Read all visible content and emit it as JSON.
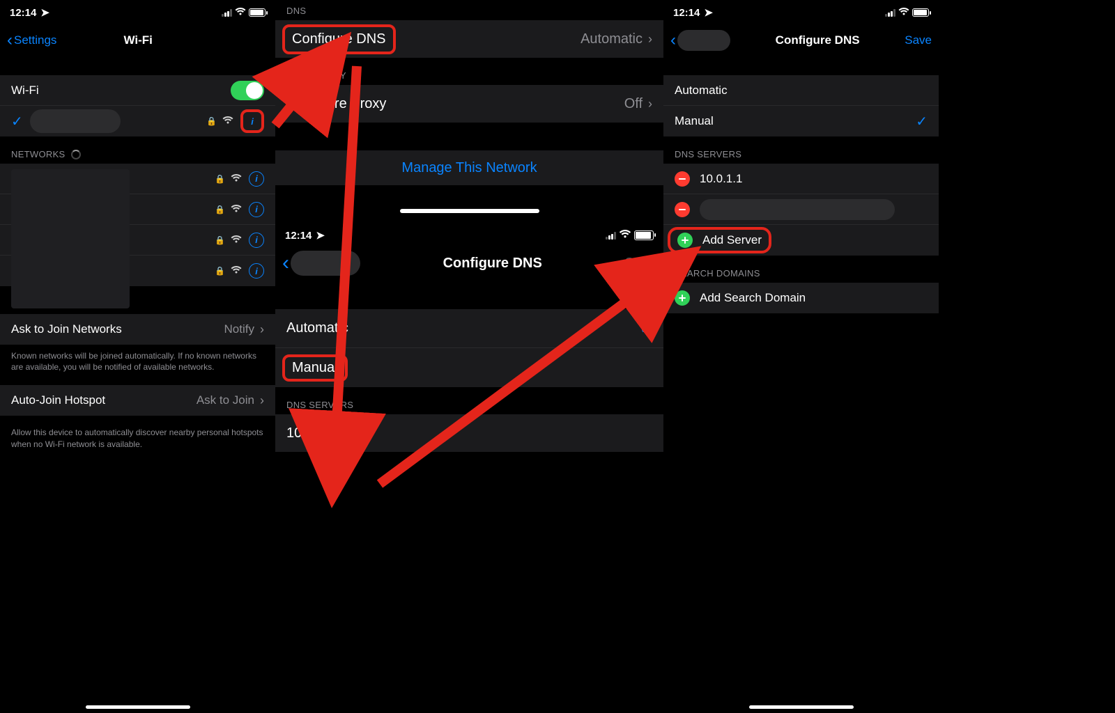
{
  "status": {
    "time": "12:14",
    "time2": "12:14"
  },
  "p1": {
    "back": "Settings",
    "title": "Wi-Fi",
    "wifi_label": "Wi-Fi",
    "networks_header": "NETWORKS",
    "ask_join_label": "Ask to Join Networks",
    "ask_join_value": "Notify",
    "ask_join_footer": "Known networks will be joined automatically. If no known networks are available, you will be notified of available networks.",
    "hotspot_label": "Auto-Join Hotspot",
    "hotspot_value": "Ask to Join",
    "hotspot_footer": "Allow this device to automatically discover nearby personal hotspots when no Wi-Fi network is available."
  },
  "p2a": {
    "dns_header": "DNS",
    "configure_dns": "Configure DNS",
    "configure_dns_value": "Automatic",
    "proxy_header": "HTTP PROXY",
    "configure_proxy": "Configure Proxy",
    "configure_proxy_value": "Off",
    "manage": "Manage This Network"
  },
  "p2b": {
    "title": "Configure DNS",
    "save": "Save",
    "automatic": "Automatic",
    "manual": "Manual",
    "dns_servers": "DNS SERVERS",
    "server1": "10.0.1.1"
  },
  "p3": {
    "title": "Configure DNS",
    "save": "Save",
    "automatic": "Automatic",
    "manual": "Manual",
    "dns_servers_header": "DNS SERVERS",
    "server1": "10.0.1.1",
    "add_server": "Add Server",
    "search_domains_header": "SEARCH DOMAINS",
    "add_domain": "Add Search Domain"
  },
  "colors": {
    "accent": "#e4251b",
    "blue": "#0a84ff",
    "green": "#30d158",
    "red": "#ff3b30"
  }
}
